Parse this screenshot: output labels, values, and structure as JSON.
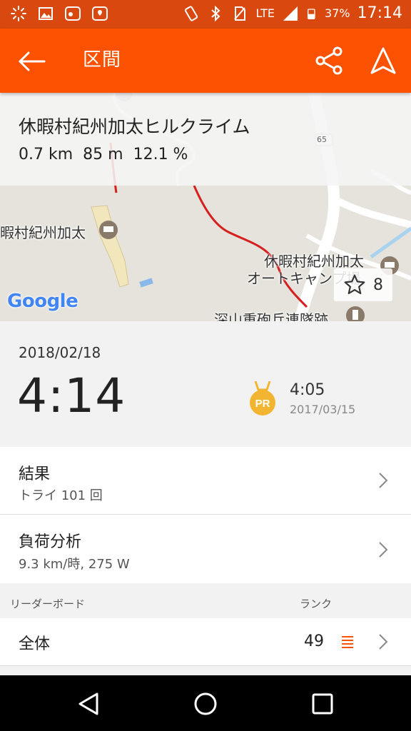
{
  "status_bar": {
    "network": "LTE",
    "battery": "37%",
    "time": "17:14"
  },
  "app_bar": {
    "title": "区間",
    "back_icon": "arrow-left-icon",
    "share_icon": "share-icon",
    "navigate_icon": "navigation-arrow-icon"
  },
  "segment": {
    "name": "休暇村紀州加太ヒルクライム",
    "distance": "0.7 km",
    "elevation": "85 m",
    "grade": "12.1 %"
  },
  "map": {
    "labels": {
      "hotel": "暇村紀州加太",
      "camp_line1": "休暇村紀州加太",
      "camp_line2": "オートキャンプ場",
      "monument": "深山重砲兵連隊跡",
      "road_number": "65"
    },
    "attribution": "Google",
    "star_count": "8"
  },
  "effort": {
    "date": "2018/02/18",
    "time": "4:14",
    "pr_badge": "PR",
    "pr_time": "4:05",
    "pr_date": "2017/03/15"
  },
  "results": {
    "title": "結果",
    "subtitle": "トライ 101 回"
  },
  "analysis": {
    "title": "負荷分析",
    "subtitle": "9.3 km/時, 275 W"
  },
  "leaderboard": {
    "header": "リーダーボード",
    "rank_header": "ランク",
    "overall_label": "全体",
    "overall_rank": "49"
  },
  "colors": {
    "accent": "#fc5200",
    "status_bar": "#d9480f",
    "route": "#d61f1f",
    "pr_medal": "#f2b531"
  }
}
